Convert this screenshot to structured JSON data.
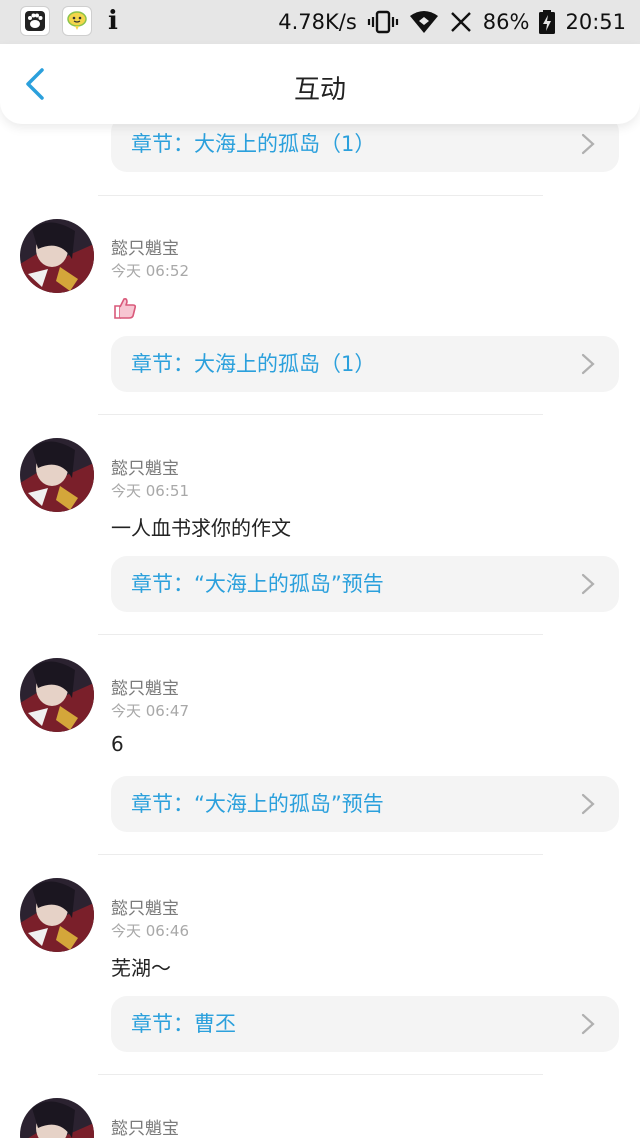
{
  "status_bar": {
    "speed": "4.78K/s",
    "battery": "86%",
    "time": "20:51",
    "left_icons": [
      "baidu-paw-icon",
      "chat-bubble-icon",
      "info-icon"
    ],
    "right_icons": [
      "vibrate-icon",
      "wifi-icon",
      "no-signal-icon",
      "battery-charging-icon"
    ]
  },
  "header": {
    "title": "互动",
    "back_icon": "chevron-left-icon"
  },
  "colors": {
    "accent": "#2ba0dc",
    "username": "#7a7a7a",
    "time": "#a8a8a8",
    "chapter_bg": "#f4f4f4"
  },
  "top_partial_chapter": "章节：大海上的孤岛（1）",
  "items": [
    {
      "username": "懿只魈宝",
      "time": "今天 06:52",
      "comment": "",
      "comment_icon": "thumbs-up-icon",
      "chapter": "章节：大海上的孤岛（1）"
    },
    {
      "username": "懿只魈宝",
      "time": "今天 06:51",
      "comment": "一人血书求你的作文",
      "chapter": "章节：“大海上的孤岛”预告"
    },
    {
      "username": "懿只魈宝",
      "time": "今天 06:47",
      "comment": "6",
      "chapter": "章节：“大海上的孤岛”预告"
    },
    {
      "username": "懿只魈宝",
      "time": "今天 06:46",
      "comment": "芜湖～",
      "chapter": "章节：曹丕"
    },
    {
      "username": "懿只魈宝",
      "time": "",
      "comment": "",
      "chapter": ""
    }
  ]
}
